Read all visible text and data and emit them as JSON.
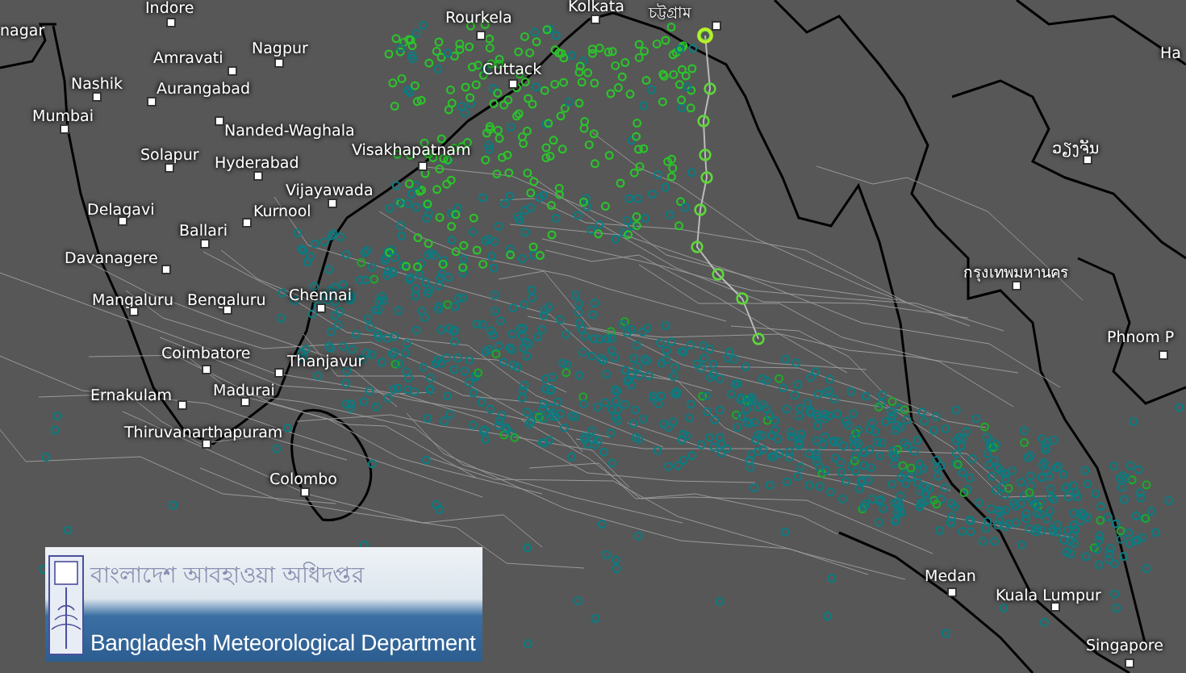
{
  "map": {
    "cities": [
      {
        "name": "nagar"
      },
      {
        "name": "Indore"
      },
      {
        "name": "Rourkela"
      },
      {
        "name": "Kolkata"
      },
      {
        "name": "Amravati"
      },
      {
        "name": "Nagpur"
      },
      {
        "name": "Nashik"
      },
      {
        "name": "Aurangabad"
      },
      {
        "name": "Mumbai"
      },
      {
        "name": "Nanded-Waghala"
      },
      {
        "name": "Cuttack"
      },
      {
        "name": "Solapur"
      },
      {
        "name": "Hyderabad"
      },
      {
        "name": "Visakhapatnam"
      },
      {
        "name": "Vijayawada"
      },
      {
        "name": "Delagavi"
      },
      {
        "name": "Kurnool"
      },
      {
        "name": "Ballari"
      },
      {
        "name": "Davanagere"
      },
      {
        "name": "Mangaluru"
      },
      {
        "name": "Bengaluru"
      },
      {
        "name": "Chennai"
      },
      {
        "name": "Coimbatore"
      },
      {
        "name": "Thanjavur"
      },
      {
        "name": "Ernakulam"
      },
      {
        "name": "Madurai"
      },
      {
        "name": "Thiruvanarthapuram"
      },
      {
        "name": "Colombo"
      },
      {
        "name": "চট্টগ্রাম"
      },
      {
        "name": "Ha"
      },
      {
        "name": "ວຽງຈັນ"
      },
      {
        "name": "กรุงเทพมหานคร"
      },
      {
        "name": "Phnom P"
      },
      {
        "name": "Medan"
      },
      {
        "name": "Kuala Lumpur"
      },
      {
        "name": "Singapore"
      }
    ]
  },
  "logo": {
    "bengali_title": "বাংলাদেশ আবহাওয়া অধিদপ্তর",
    "english_title": "Bangladesh Meteorological Department"
  }
}
